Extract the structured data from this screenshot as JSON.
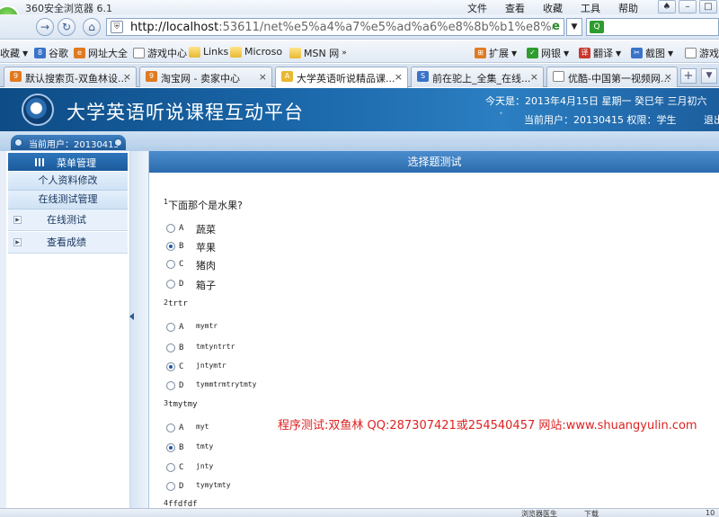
{
  "browser": {
    "title": "360安全浏览器 6.1",
    "menus": [
      "文件",
      "查看",
      "收藏",
      "工具",
      "帮助"
    ],
    "address": {
      "host": "http://localhost",
      "rest": ":53611/net%e5%a4%a7%e5%ad%a6%e8%8b%b1%e8%af%a"
    },
    "favorites": [
      {
        "label": "收藏",
        "icon": "star-icon"
      },
      {
        "label": "谷歌",
        "icon": "google-icon"
      },
      {
        "label": "网址大全",
        "icon": "globe-icon"
      },
      {
        "label": "游戏中心",
        "icon": "page-icon"
      },
      {
        "label": "Links",
        "icon": "folder-icon"
      },
      {
        "label": "Microso",
        "icon": "folder-icon"
      },
      {
        "label": "MSN 网",
        "icon": "folder-icon"
      },
      {
        "label": "扩展",
        "icon": "extension-icon"
      },
      {
        "label": "网银",
        "icon": "bank-icon"
      },
      {
        "label": "翻译",
        "icon": "translate-icon"
      },
      {
        "label": "截图",
        "icon": "screenshot-icon"
      },
      {
        "label": "游戏",
        "icon": "game-icon"
      }
    ],
    "tabs": [
      {
        "label": "默认搜索页-双鱼林设...",
        "active": false
      },
      {
        "label": "淘宝网 - 卖家中心",
        "active": false
      },
      {
        "label": "大学英语听说精品课...",
        "active": true
      },
      {
        "label": "前在驼上_全集_在线...",
        "active": false
      },
      {
        "label": "优酷-中国第一视频网...",
        "active": false
      }
    ],
    "status": {
      "left": "浏览器医生",
      "download": "下载",
      "zoom": "10"
    }
  },
  "site": {
    "title": "大学英语听说课程互动平台",
    "dateline": "今天是：2013年4月15日 星期一 癸巳年 三月初六",
    "userline": "当前用户：20130415 权限：学生",
    "logout": "退出",
    "badge": "当前用户：20130415"
  },
  "menu": {
    "header": "菜单管理",
    "sub_items": [
      "个人资料修改",
      "在线测试管理"
    ],
    "tree_items": [
      "在线测试",
      "查看成绩"
    ]
  },
  "panel": {
    "title": "选择题测试"
  },
  "questions": [
    {
      "num": "1",
      "text": "下面那个是水果?",
      "mono": false,
      "selected": 1,
      "options": [
        {
          "letter": "A",
          "text": "蔬菜"
        },
        {
          "letter": "B",
          "text": "苹果"
        },
        {
          "letter": "C",
          "text": "猪肉"
        },
        {
          "letter": "D",
          "text": "箱子"
        }
      ]
    },
    {
      "num": "2",
      "text": "trtr",
      "mono": true,
      "selected": 2,
      "options": [
        {
          "letter": "A",
          "text": "mymtr"
        },
        {
          "letter": "B",
          "text": "tmtyntrtr"
        },
        {
          "letter": "C",
          "text": "jntymtr"
        },
        {
          "letter": "D",
          "text": "tymmtrmtrytmty"
        }
      ]
    },
    {
      "num": "3",
      "text": "tmytmy",
      "mono": true,
      "selected": 1,
      "options": [
        {
          "letter": "A",
          "text": "myt"
        },
        {
          "letter": "B",
          "text": "tmty"
        },
        {
          "letter": "C",
          "text": "jnty"
        },
        {
          "letter": "D",
          "text": "tymytmty"
        }
      ]
    },
    {
      "num": "4",
      "text": "ffdfdf",
      "mono": true,
      "selected": -1,
      "options": []
    }
  ],
  "watermark": "程序测试:双鱼林 QQ:287307421或254540457 网站:www.shuangyulin.com"
}
